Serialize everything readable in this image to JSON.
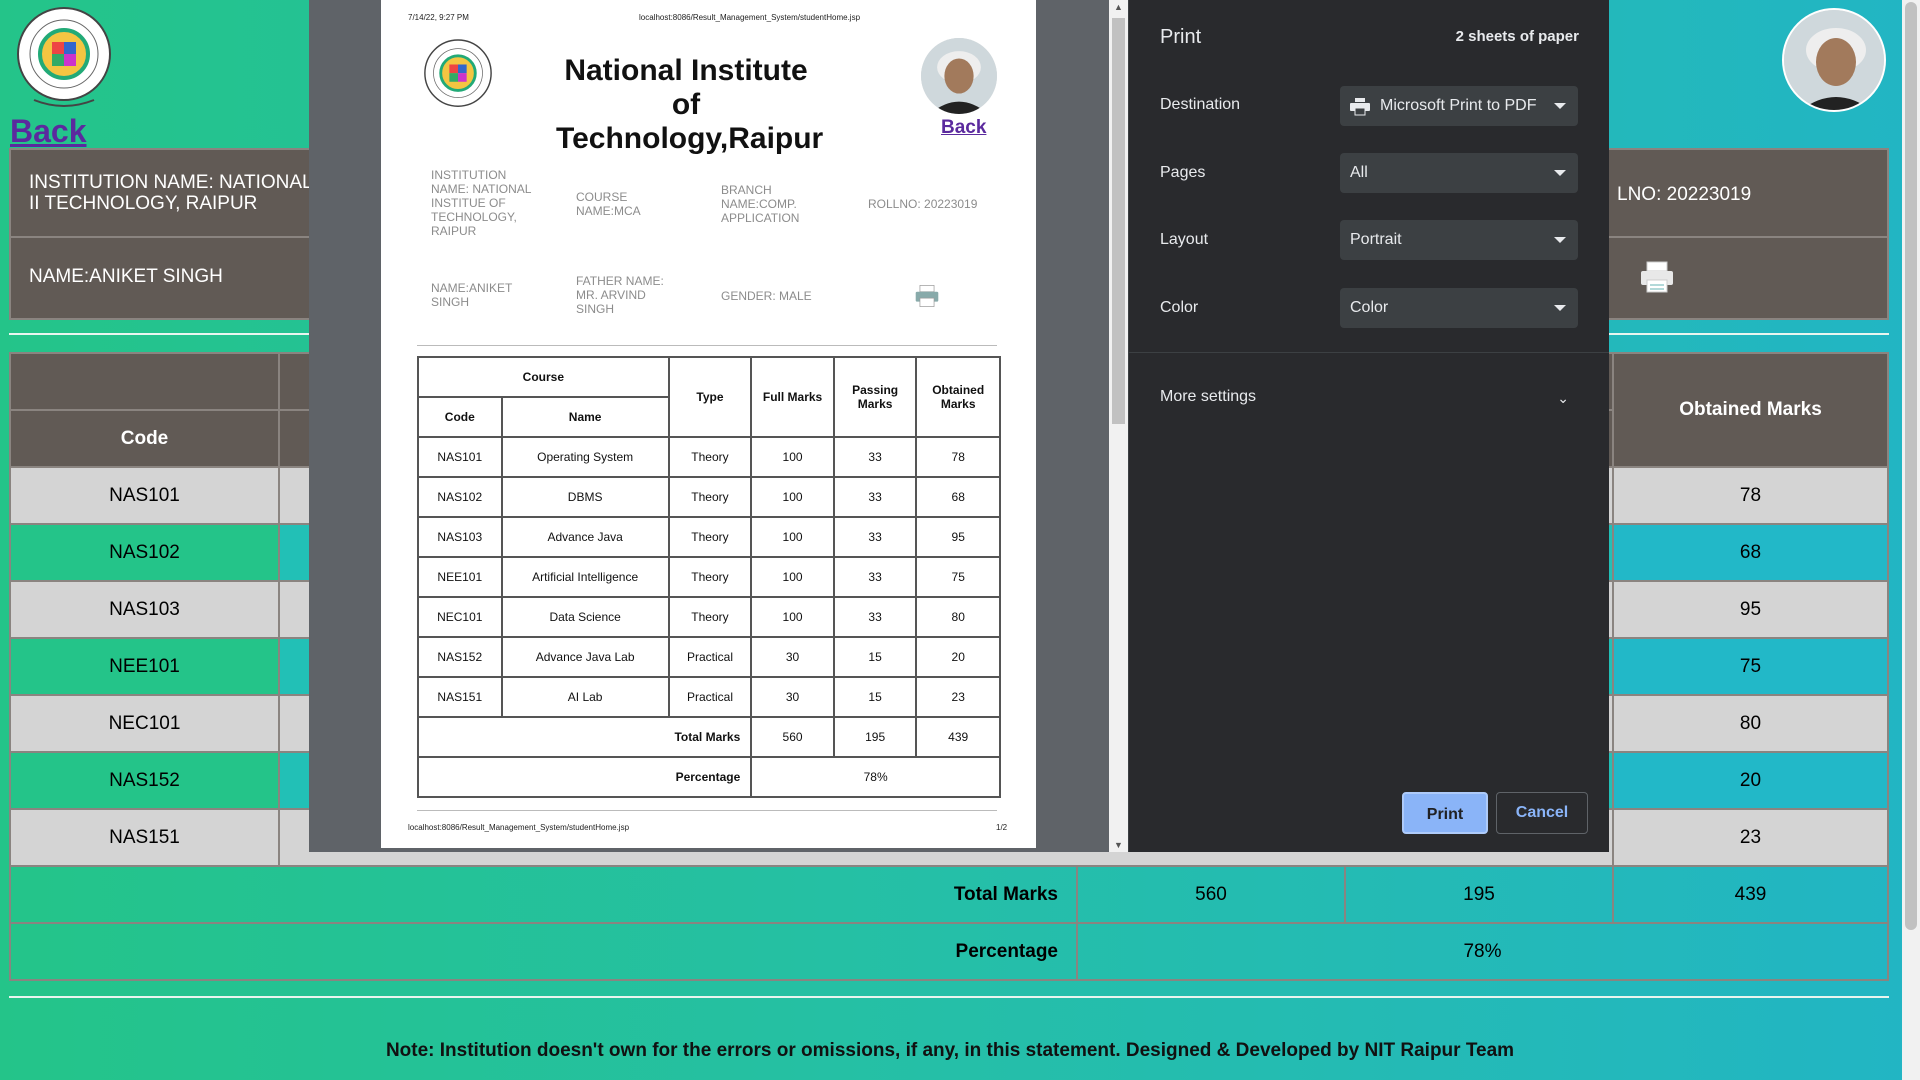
{
  "background": {
    "back_label": "Back",
    "institution_name": "INSTITUTION NAME: NATIONAL INSTITUTE OF TECHNOLOGY, RAIPUR",
    "institution_name_visible": "INSTITUTION NAME: NATIONAL II TECHNOLOGY, RAIPUR",
    "student_name": "NAME:ANIKET SINGH",
    "rollno": "LNO: 20223019",
    "headers": {
      "code": "Code",
      "obtained": "Obtained Marks"
    },
    "rows": [
      {
        "code": "NAS101",
        "obtained": "78"
      },
      {
        "code": "NAS102",
        "obtained": "68"
      },
      {
        "code": "NAS103",
        "obtained": "95"
      },
      {
        "code": "NEE101",
        "obtained": "75"
      },
      {
        "code": "NEC101",
        "obtained": "80"
      },
      {
        "code": "NAS152",
        "obtained": "20"
      },
      {
        "code": "NAS151",
        "obtained": "23"
      }
    ],
    "total_label": "Total Marks",
    "total_full": "560",
    "total_passing": "195",
    "total_obtained": "439",
    "percentage_label": "Percentage",
    "percentage_value": "78%",
    "note": "Note: Institution doesn't own for the errors or omissions, if any, in this statement. Designed & Developed by NIT Raipur Team"
  },
  "preview": {
    "header_date": "7/14/22, 9:27 PM",
    "header_url": "localhost:8086/Result_Management_System/studentHome.jsp",
    "title": "National Institute of Technology,Raipur",
    "back_label": "Back",
    "info": {
      "institution": "INSTITUTION NAME: NATIONAL INSTITUE OF TECHNOLOGY, RAIPUR",
      "course": "COURSE NAME:MCA",
      "branch": "BRANCH NAME:COMP. APPLICATION",
      "rollno": "ROLLNO: 20223019",
      "name": "NAME:ANIKET SINGH",
      "father": "FATHER NAME: MR. ARVIND SINGH",
      "gender": "GENDER: MALE"
    },
    "table": {
      "course_header": "Course",
      "code_header": "Code",
      "name_header": "Name",
      "type_header": "Type",
      "full_header": "Full Marks",
      "passing_header": "Passing Marks",
      "obtained_header": "Obtained Marks",
      "rows": [
        {
          "code": "NAS101",
          "name": "Operating System",
          "type": "Theory",
          "full": "100",
          "passing": "33",
          "obtained": "78"
        },
        {
          "code": "NAS102",
          "name": "DBMS",
          "type": "Theory",
          "full": "100",
          "passing": "33",
          "obtained": "68"
        },
        {
          "code": "NAS103",
          "name": "Advance Java",
          "type": "Theory",
          "full": "100",
          "passing": "33",
          "obtained": "95"
        },
        {
          "code": "NEE101",
          "name": "Artificial Intelligence",
          "type": "Theory",
          "full": "100",
          "passing": "33",
          "obtained": "75"
        },
        {
          "code": "NEC101",
          "name": "Data Science",
          "type": "Theory",
          "full": "100",
          "passing": "33",
          "obtained": "80"
        },
        {
          "code": "NAS152",
          "name": "Advance Java Lab",
          "type": "Practical",
          "full": "30",
          "passing": "15",
          "obtained": "20"
        },
        {
          "code": "NAS151",
          "name": "AI Lab",
          "type": "Practical",
          "full": "30",
          "passing": "15",
          "obtained": "23"
        }
      ],
      "total_label": "Total Marks",
      "total_full": "560",
      "total_passing": "195",
      "total_obtained": "439",
      "percentage_label": "Percentage",
      "percentage_value": "78%"
    },
    "footer_url": "localhost:8086/Result_Management_System/studentHome.jsp",
    "footer_page": "1/2"
  },
  "print_panel": {
    "title": "Print",
    "sheets": "2 sheets of paper",
    "destination_label": "Destination",
    "destination_value": "Microsoft Print to PDF",
    "pages_label": "Pages",
    "pages_value": "All",
    "layout_label": "Layout",
    "layout_value": "Portrait",
    "color_label": "Color",
    "color_value": "Color",
    "more_settings": "More settings",
    "print_button": "Print",
    "cancel_button": "Cancel"
  }
}
